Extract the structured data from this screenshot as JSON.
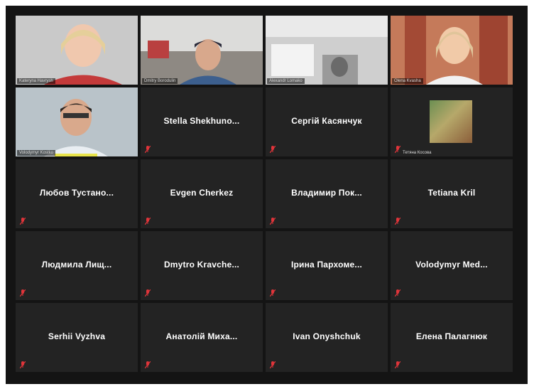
{
  "tiles": [
    {
      "type": "video",
      "caption": "Kateryna Havrysh"
    },
    {
      "type": "video",
      "caption": "Dmitry Borodulin"
    },
    {
      "type": "video",
      "caption": "Alexandr Lomako"
    },
    {
      "type": "video",
      "caption": "Olena Kvasha",
      "active": true
    },
    {
      "type": "video",
      "caption": "Volodymyr Kostko"
    },
    {
      "type": "name",
      "name": "Stella Shekhuno...",
      "muted": true
    },
    {
      "type": "name",
      "name": "Сергій Касянчук",
      "muted": true
    },
    {
      "type": "thumb",
      "caption": "Тетяна Косова",
      "muted": true
    },
    {
      "type": "name",
      "name": "Любов Тустано...",
      "muted": true
    },
    {
      "type": "name",
      "name": "Evgen Cherkez",
      "muted": true
    },
    {
      "type": "name",
      "name": "Владимир Пок...",
      "muted": true
    },
    {
      "type": "name",
      "name": "Tetiana Kril",
      "muted": true
    },
    {
      "type": "name",
      "name": "Людмила Лищ...",
      "muted": true
    },
    {
      "type": "name",
      "name": "Dmytro Kravche...",
      "muted": true
    },
    {
      "type": "name",
      "name": "Ірина Пархоме...",
      "muted": true
    },
    {
      "type": "name",
      "name": "Volodymyr Med...",
      "muted": true
    },
    {
      "type": "name",
      "name": "Serhii Vyzhva",
      "muted": true
    },
    {
      "type": "name",
      "name": "Анатолій Миха...",
      "muted": true
    },
    {
      "type": "name",
      "name": "Ivan Onyshchuk",
      "muted": true
    },
    {
      "type": "name",
      "name": "Елена Палагнюк",
      "muted": true
    }
  ],
  "colors": {
    "background": "#141414",
    "tile": "#232323",
    "active_speaker": "#e7e34a",
    "muted_icon": "#e0343a"
  },
  "icons": {
    "muted": "mic-muted-icon"
  }
}
